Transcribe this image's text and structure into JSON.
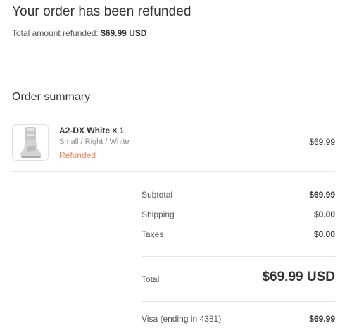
{
  "header": {
    "title": "Your order has been refunded",
    "refund_label": "Total amount refunded:",
    "refund_amount": "$69.99 USD"
  },
  "summary": {
    "title": "Order summary",
    "item": {
      "name": "A2-DX White × 1",
      "variant": "Small / Right / White",
      "status": "Refunded",
      "price": "$69.99",
      "image_icon": "ankle-brace-product-image"
    },
    "subtotal_label": "Subtotal",
    "subtotal_value": "$69.99",
    "shipping_label": "Shipping",
    "shipping_value": "$0.00",
    "taxes_label": "Taxes",
    "taxes_value": "$0.00",
    "total_label": "Total",
    "total_value": "$69.99 USD",
    "payment_label": "Visa (ending in 4381)",
    "payment_value": "$69.99"
  },
  "colors": {
    "refunded_status": "#e8855c",
    "divider": "#e3e3e3"
  }
}
